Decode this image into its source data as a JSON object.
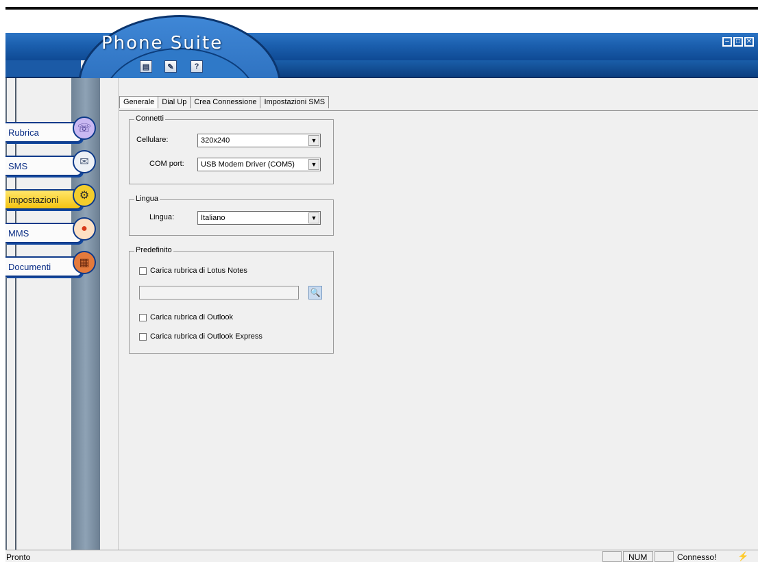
{
  "window": {
    "title": "Phone Suite",
    "controls": {
      "minimize": "–",
      "maximize": "□",
      "close": "✕"
    }
  },
  "toolbar": [
    {
      "icon": "document-icon",
      "glyph": "▤"
    },
    {
      "icon": "edit-icon",
      "glyph": "✎"
    },
    {
      "icon": "help-icon",
      "glyph": "?"
    }
  ],
  "sidebar": {
    "items": [
      {
        "label": "Rubrica",
        "icon": "phone-icon",
        "glyph": "☏",
        "active": false
      },
      {
        "label": "SMS",
        "icon": "envelope-icon",
        "glyph": "✉",
        "active": false
      },
      {
        "label": "Impostazioni",
        "icon": "settings-icon",
        "glyph": "⚙",
        "active": true
      },
      {
        "label": "MMS",
        "icon": "balloon-icon",
        "glyph": "●",
        "active": false
      },
      {
        "label": "Documenti",
        "icon": "folder-icon",
        "glyph": "▦",
        "active": false
      }
    ]
  },
  "tabs": [
    "Generale",
    "Dial Up",
    "Crea Connessione",
    "Impostazioni SMS"
  ],
  "connetti": {
    "legend": "Connetti",
    "cellulare_label": "Cellulare:",
    "cellulare_value": "320x240",
    "com_label": "COM port:",
    "com_value": "USB Modem Driver (COM5)"
  },
  "lingua": {
    "legend": "Lingua",
    "label": "Lingua:",
    "value": "Italiano"
  },
  "predefinito": {
    "legend": "Predefinito",
    "lotus_label": "Carica rubrica di Lotus Notes",
    "lotus_path": "",
    "outlook_label": "Carica rubrica di Outlook",
    "outlook_express_label": "Carica rubrica di Outlook Express"
  },
  "statusbar": {
    "status": "Pronto",
    "num": "NUM",
    "connection": "Connesso!"
  },
  "colors": {
    "title_blue": "#1b5fae",
    "nav_border": "#0e3a8a",
    "active_nav": "#f4c311"
  }
}
